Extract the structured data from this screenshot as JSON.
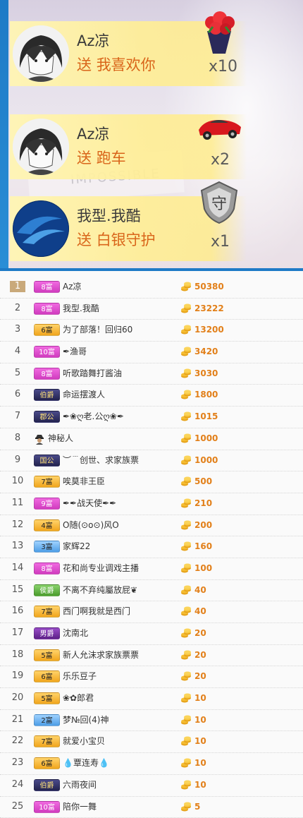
{
  "gifts": [
    {
      "user": "Az凉",
      "action": "送",
      "gift_name": "我喜欢你",
      "count": "x10",
      "avatar": "anime-avatar",
      "gift_icon": "rose-bouquet-icon"
    },
    {
      "user": "Az凉",
      "action": "送",
      "gift_name": "跑车",
      "count": "x2",
      "avatar": "anime-avatar",
      "gift_icon": "sports-car-icon"
    },
    {
      "user": "我型.我酷",
      "action": "送",
      "gift_name": "白银守护",
      "count": "x1",
      "avatar": "blue-swirl-avatar",
      "gift_icon": "silver-guard-shield-icon"
    }
  ],
  "background_text": "IMPOSSIBLE",
  "ranking": [
    {
      "rank": "1",
      "badge": "8富",
      "badge_color": "pink",
      "name": "Az凉",
      "score": "50380"
    },
    {
      "rank": "2",
      "badge": "8富",
      "badge_color": "pink",
      "name": "我型.我酷",
      "score": "23222"
    },
    {
      "rank": "3",
      "badge": "6富",
      "badge_color": "orange",
      "name": "为了部落！回归60",
      "score": "13200"
    },
    {
      "rank": "4",
      "badge": "10富",
      "badge_color": "pink",
      "name": "✒渔哥",
      "score": "3420"
    },
    {
      "rank": "5",
      "badge": "8富",
      "badge_color": "pink",
      "name": "听歌踏舞打酱油",
      "score": "3030"
    },
    {
      "rank": "6",
      "badge": "伯爵",
      "badge_color": "dark",
      "name": "命运摆渡人",
      "score": "1800"
    },
    {
      "rank": "7",
      "badge": "郡公",
      "badge_color": "dark",
      "name": "✒❀ღ老.公ღ❀✒",
      "score": "1015"
    },
    {
      "rank": "8",
      "badge": "",
      "badge_color": "mystery",
      "name": "神秘人",
      "score": "1000"
    },
    {
      "rank": "9",
      "badge": "国公",
      "badge_color": "dark",
      "name": "︶﹉创世、求家族票",
      "score": "1000"
    },
    {
      "rank": "10",
      "badge": "7富",
      "badge_color": "orange",
      "name": "唉莫非王臣",
      "score": "500"
    },
    {
      "rank": "11",
      "badge": "9富",
      "badge_color": "pink",
      "name": "✒✒战天使✒✒",
      "score": "210"
    },
    {
      "rank": "12",
      "badge": "4富",
      "badge_color": "orange",
      "name": "O随(⊙o⊙)风O",
      "score": "200"
    },
    {
      "rank": "13",
      "badge": "3富",
      "badge_color": "blue",
      "name": "家辉22",
      "score": "160"
    },
    {
      "rank": "14",
      "badge": "8富",
      "badge_color": "pink",
      "name": "花和尚专业调戏主播",
      "score": "100"
    },
    {
      "rank": "15",
      "badge": "侯爵",
      "badge_color": "green",
      "name": "不离不弃纯屬放屁❦",
      "score": "40"
    },
    {
      "rank": "16",
      "badge": "7富",
      "badge_color": "orange",
      "name": "西门啊我就是西门",
      "score": "40"
    },
    {
      "rank": "17",
      "badge": "男爵",
      "badge_color": "purple",
      "name": "沈南北",
      "score": "20"
    },
    {
      "rank": "18",
      "badge": "5富",
      "badge_color": "orange",
      "name": "新人允沫求家族票票",
      "score": "20"
    },
    {
      "rank": "19",
      "badge": "6富",
      "badge_color": "orange",
      "name": "乐乐豆子",
      "score": "20"
    },
    {
      "rank": "20",
      "badge": "5富",
      "badge_color": "orange",
      "name": "❀✿郎君",
      "score": "10"
    },
    {
      "rank": "21",
      "badge": "2富",
      "badge_color": "blue",
      "name": "梦№回(4)神",
      "score": "10"
    },
    {
      "rank": "22",
      "badge": "7富",
      "badge_color": "orange",
      "name": "就爱小宝贝",
      "score": "10"
    },
    {
      "rank": "23",
      "badge": "6富",
      "badge_color": "orange",
      "name": "💧覃连寿💧",
      "score": "10"
    },
    {
      "rank": "24",
      "badge": "伯爵",
      "badge_color": "dark",
      "name": "六雨夜间",
      "score": "10"
    },
    {
      "rank": "25",
      "badge": "10富",
      "badge_color": "pink",
      "name": "陪你一舞",
      "score": "5"
    }
  ]
}
